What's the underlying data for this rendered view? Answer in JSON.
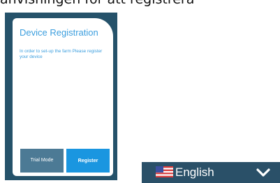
{
  "background_text": "anvisningen för att registrera",
  "dialog": {
    "title": "Device Registration",
    "message": "In order to set-up the farm Please register your device",
    "trial_button": "Trial Mode",
    "register_button": "Register"
  },
  "language": {
    "selected": "English",
    "flag_icon": "us-flag-icon",
    "dropdown_icon": "chevron-down-icon"
  },
  "colors": {
    "frame": "#25526a",
    "accent": "#3b9ede",
    "register_button": "#1a96e0",
    "trial_button": "#4c7a95",
    "language_bar": "#2a5068"
  }
}
